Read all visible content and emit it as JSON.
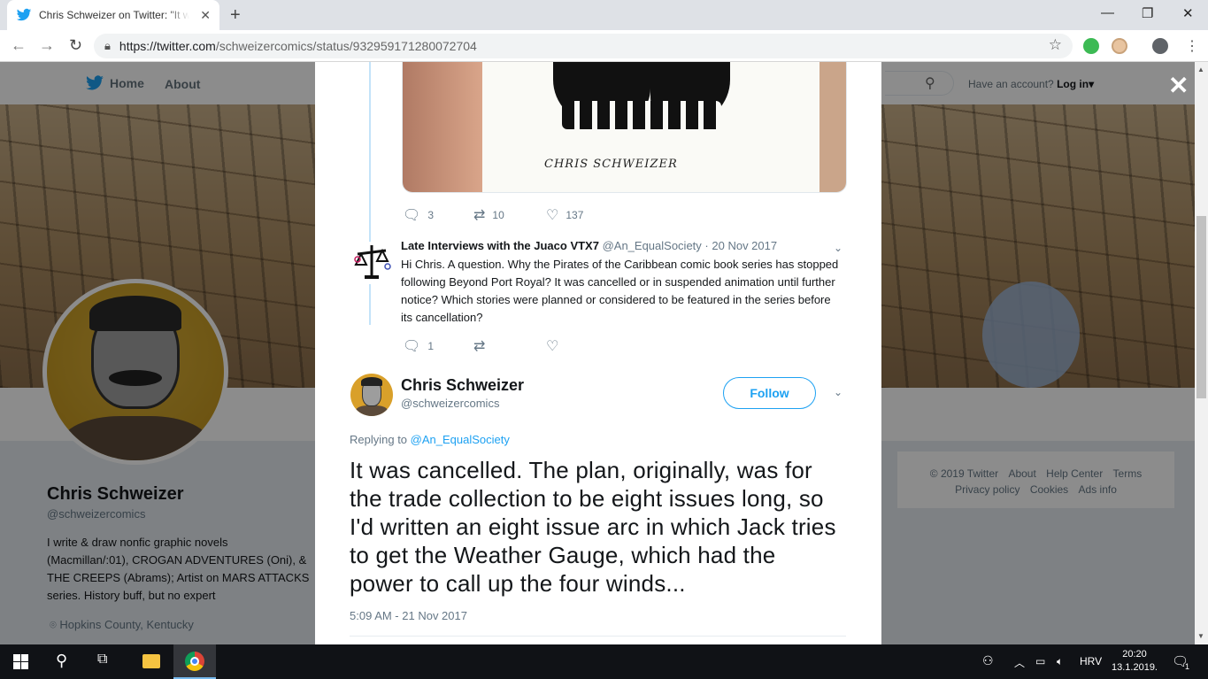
{
  "browser": {
    "tab_title": "Chris Schweizer on Twitter: \"It wa",
    "url_host": "https://twitter.com",
    "url_path": "/schweizercomics/status/932959171280072704"
  },
  "twitter_nav": {
    "home": "Home",
    "about": "About",
    "have_account": "Have an account?",
    "login": "Log in"
  },
  "profile": {
    "name": "Chris Schweizer",
    "handle": "@schweizercomics",
    "bio": "I write & draw nonfic graphic novels (Macmillan/:01), CROGAN ADVENTURES (Oni), & THE CREEPS (Abrams); Artist on MARS ATTACKS series. History buff, but no expert",
    "location": "Hopkins County, Kentucky"
  },
  "footer": {
    "links": [
      "© 2019 Twitter",
      "About",
      "Help Center",
      "Terms",
      "Privacy policy",
      "Cookies",
      "Ads info"
    ]
  },
  "parent_tweet": {
    "artwork_signature": "CHRIS SCHWEIZER",
    "replies": "3",
    "retweets": "10",
    "likes": "137"
  },
  "reply_tweet": {
    "author": "Late Interviews with the Juaco VTX7",
    "handle": "@An_EqualSociety",
    "date": "20 Nov 2017",
    "text": "Hi Chris. A question. Why the Pirates of the Caribbean comic book series has stopped following Beyond Port Royal? It was cancelled or in suspended animation until further notice? Which stories were planned or considered to be featured in the series before its cancellation?",
    "replies": "1"
  },
  "main_tweet": {
    "author": "Chris Schweizer",
    "handle": "@schweizercomics",
    "follow_label": "Follow",
    "replying_prefix": "Replying to",
    "replying_to": "@An_EqualSociety",
    "text": "It was cancelled. The plan, originally, was for the trade collection to be eight issues long, so I'd written an eight issue arc in which Jack tries to get the Weather Gauge, which had the power to call up the four winds...",
    "timestamp": "5:09 AM - 21 Nov 2017"
  },
  "taskbar": {
    "language": "HRV",
    "time": "20:20",
    "date": "13.1.2019.",
    "notification_count": "1"
  },
  "icons": {
    "reply": "reply-icon",
    "retweet": "retweet-icon",
    "like": "heart-icon",
    "close": "close-icon",
    "caret": "chevron-down-icon"
  },
  "colors": {
    "twitter_blue": "#1da1f2",
    "thread_line": "#c4e3f9",
    "text_primary": "#14171a",
    "text_secondary": "#657786"
  }
}
